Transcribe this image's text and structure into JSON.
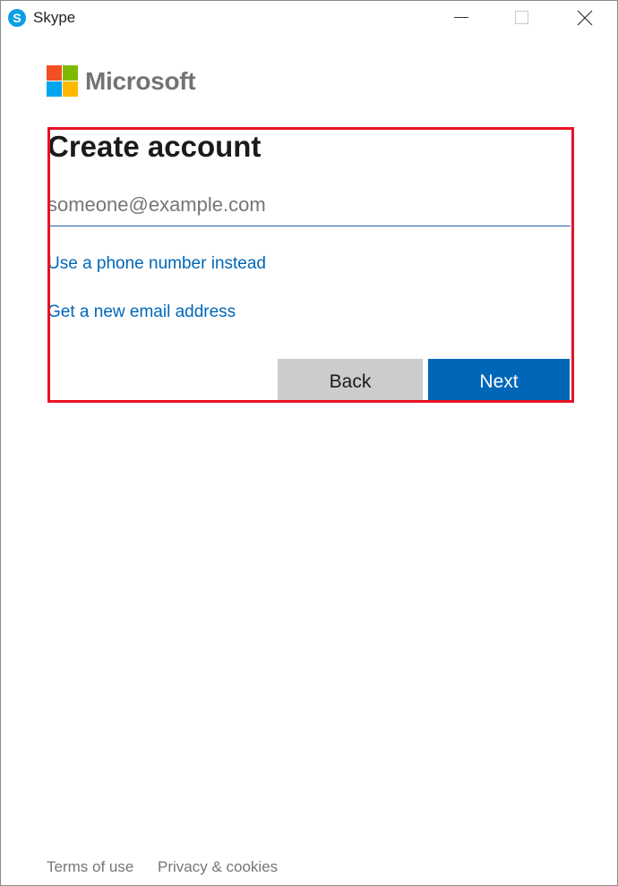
{
  "window": {
    "title": "Skype",
    "icon": "skype-icon",
    "controls": [
      "minimize-icon",
      "maximize-icon",
      "close-icon"
    ]
  },
  "brand": {
    "name": "Microsoft",
    "logo": "microsoft-logo",
    "colors": [
      "#f25022",
      "#7fba00",
      "#00a4ef",
      "#ffb900"
    ]
  },
  "form": {
    "heading": "Create account",
    "email_placeholder": "someone@example.com",
    "email_value": "",
    "phone_link": "Use a phone number instead",
    "new_email_link": "Get a new email address",
    "back_label": "Back",
    "next_label": "Next"
  },
  "footer": {
    "terms": "Terms of use",
    "privacy": "Privacy & cookies"
  },
  "colors": {
    "accent": "#0067b8",
    "highlight": "#e81123",
    "back_button": "#cccccc"
  }
}
